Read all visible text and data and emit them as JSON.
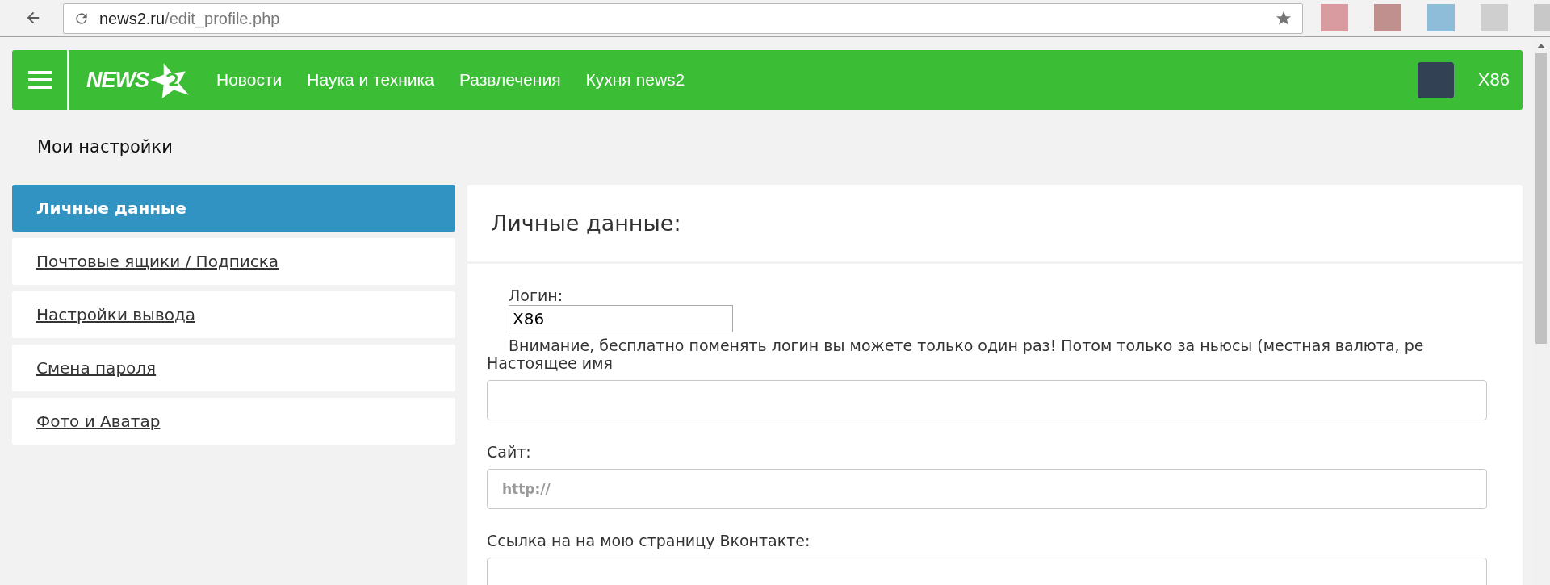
{
  "browser": {
    "url_host": "news2.ru",
    "url_path": "/edit_profile.php"
  },
  "header": {
    "logo": "NEWS",
    "nav": [
      {
        "label": "Новости"
      },
      {
        "label": "Наука и техника"
      },
      {
        "label": "Развлечения"
      },
      {
        "label": "Кухня news2"
      }
    ],
    "username": "X86"
  },
  "page_title": "Мои настройки",
  "sidebar": {
    "items": [
      {
        "label": "Личные данные",
        "selected": true
      },
      {
        "label": "Почтовые ящики / Подписка",
        "selected": false
      },
      {
        "label": "Настройки вывода",
        "selected": false
      },
      {
        "label": "Смена пароля",
        "selected": false
      },
      {
        "label": "Фото и Аватар",
        "selected": false
      }
    ]
  },
  "panel": {
    "title": "Личные данные:",
    "login": {
      "label": "Логин:",
      "value": "X86",
      "note": "Внимание, бесплатно поменять логин вы можете только один раз! Потом только за ньюсы (местная валюта, ре"
    },
    "fields": [
      {
        "label": "Настоящее имя"
      },
      {
        "label": "Сайт:",
        "placeholder": "http://"
      },
      {
        "label": "Ссылка на на мою страницу Вконтакте:"
      }
    ]
  }
}
